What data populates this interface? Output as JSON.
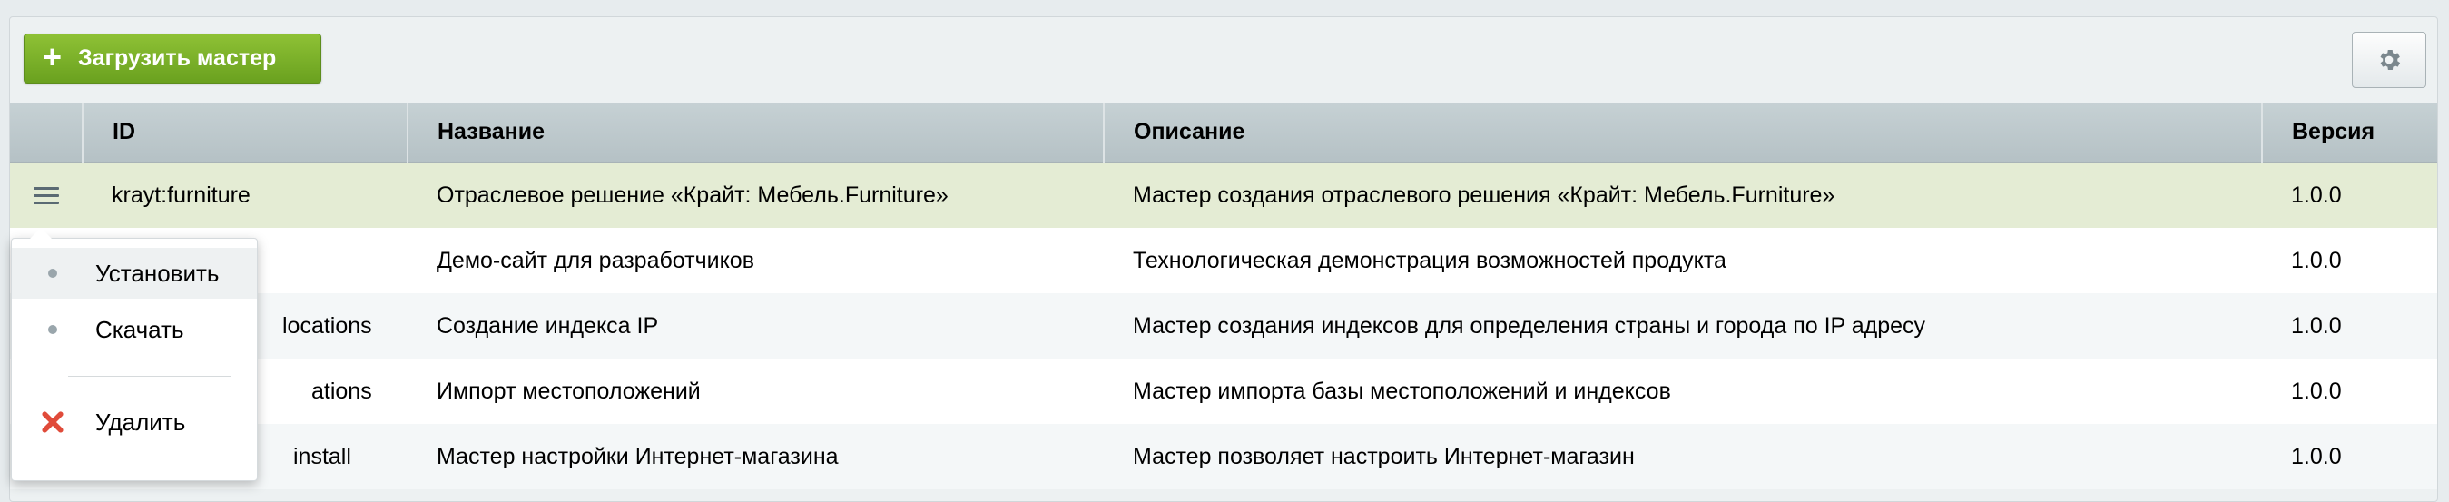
{
  "toolbar": {
    "upload_label": "Загрузить мастер",
    "upload_icon": "plus-icon",
    "settings_icon": "gear-icon"
  },
  "table": {
    "columns": [
      "ID",
      "Название",
      "Описание",
      "Версия"
    ],
    "rows": [
      {
        "id": "krayt:furniture",
        "name": "Отраслевое решение «Крайт: Мебель.Furniture»",
        "description": "Мастер создания отраслевого решения «Крайт: Мебель.Furniture»",
        "version": "1.0.0"
      },
      {
        "id": "",
        "name": "Демо-сайт для разработчиков",
        "description": "Технологическая демонстрация возможностей продукта",
        "version": "1.0.0"
      },
      {
        "id": "locations",
        "name": "Создание индекса IP",
        "description": "Мастер создания индексов для определения страны и города по IP адресу",
        "version": "1.0.0"
      },
      {
        "id": "ations",
        "name": "Импорт местоположений",
        "description": "Мастер импорта базы местоположений и индексов",
        "version": "1.0.0"
      },
      {
        "id": "install",
        "name": "Мастер настройки Интернет-магазина",
        "description": "Мастер позволяет настроить Интернет-магазин",
        "version": "1.0.0"
      }
    ]
  },
  "context_menu": {
    "install_label": "Установить",
    "download_label": "Скачать",
    "delete_label": "Удалить"
  },
  "colors": {
    "accent_green": "#7ab229",
    "active_row": "#e4ecd4",
    "delete_red": "#e04b3a"
  }
}
